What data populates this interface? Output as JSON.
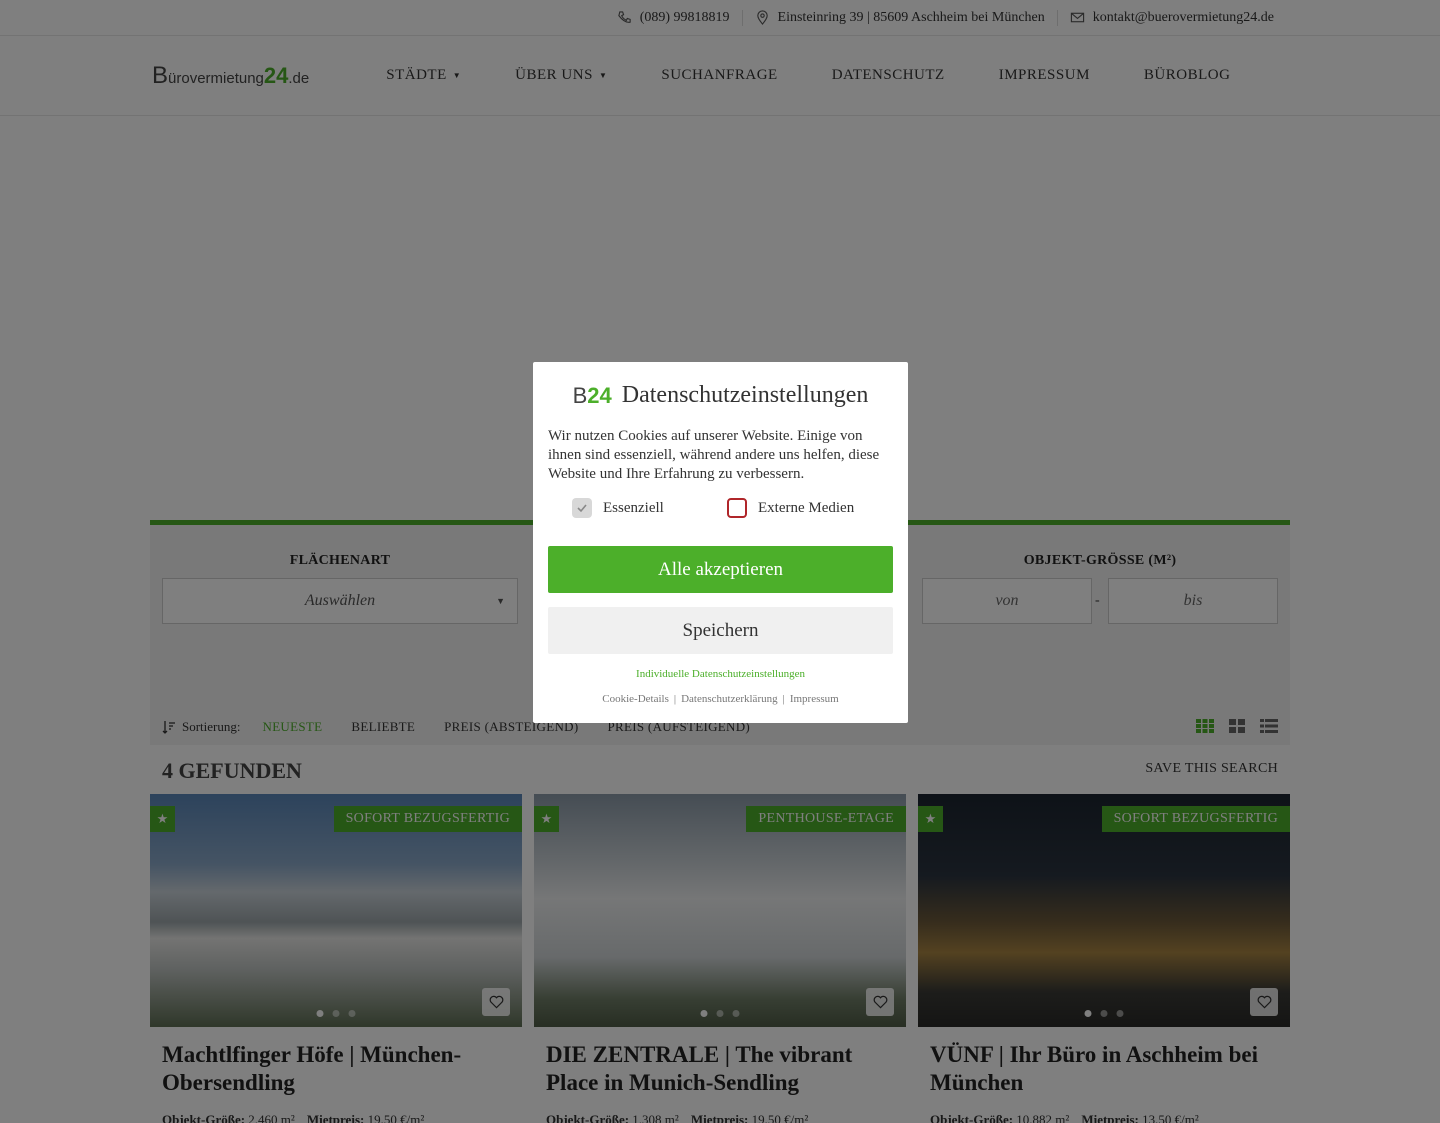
{
  "topbar": {
    "phone": "(089) 99818819",
    "address": "Einsteinring 39 | 85609 Aschheim bei München",
    "email": "kontakt@buerovermietung24.de"
  },
  "logo": {
    "b": "B",
    "text": "ürovermietung",
    "num": "24",
    "tld": ".de"
  },
  "nav": [
    {
      "label": "STÄDTE",
      "has_caret": true
    },
    {
      "label": "ÜBER UNS",
      "has_caret": true
    },
    {
      "label": "SUCHANFRAGE",
      "has_caret": false
    },
    {
      "label": "DATENSCHUTZ",
      "has_caret": false
    },
    {
      "label": "IMPRESSUM",
      "has_caret": false
    },
    {
      "label": "BÜROBLOG",
      "has_caret": false
    }
  ],
  "search": {
    "flaechenart_label": "FLÄCHENART",
    "flaechenart_value": "Auswählen",
    "groesse_label": "OBJEKT-GRÖSSE (M²)",
    "from_placeholder": "von",
    "to_placeholder": "bis",
    "dash": "-"
  },
  "sort": {
    "label": "Sortierung:",
    "options": [
      {
        "label": "Neueste",
        "active": true
      },
      {
        "label": "Beliebte",
        "active": false
      },
      {
        "label": "Preis (absteigend)",
        "active": false
      },
      {
        "label": "Preis (aufsteigend)",
        "active": false
      }
    ]
  },
  "results": {
    "count_label": "4 GEFUNDEN",
    "save_label": "SAVE THIS SEARCH"
  },
  "cards": [
    {
      "badge": "SOFORT BEZUGSFERTIG",
      "title": "Machtlfinger Höfe | München-Obersendling",
      "size_label": "Objekt-Größe:",
      "size": "2.460 m²",
      "price_label": "Mietpreis:",
      "price": "19,50 €/m²"
    },
    {
      "badge": "PENTHOUSE-ETAGE",
      "title": "DIE ZENTRALE | The vibrant Place in Munich-Sendling",
      "size_label": "Objekt-Größe:",
      "size": "1.308 m²",
      "price_label": "Mietpreis:",
      "price": "19,50 €/m²"
    },
    {
      "badge": "SOFORT BEZUGSFERTIG",
      "title": "VÜNF | Ihr Büro in Aschheim bei München",
      "size_label": "Objekt-Größe:",
      "size": "10.882 m²",
      "price_label": "Mietpreis:",
      "price": "13,50 €/m²"
    }
  ],
  "modal": {
    "logo_b": "B",
    "logo_num": "24",
    "title": "Datenschutzeinstellungen",
    "text": "Wir nutzen Cookies auf unserer Website. Einige von ihnen sind essenziell, während andere uns helfen, diese Website und Ihre Erfahrung zu verbessern.",
    "check_essential": "Essenziell",
    "check_external": "Externe Medien",
    "accept_label": "Alle akzeptieren",
    "save_label": "Speichern",
    "individual_link": "Individuelle Datenschutzeinstellungen",
    "footer_links": [
      "Cookie-Details",
      "Datenschutzerklärung",
      "Impressum"
    ],
    "footer_sep": "|"
  },
  "colors": {
    "accent": "#4caf2a",
    "alert": "#b0262a"
  }
}
